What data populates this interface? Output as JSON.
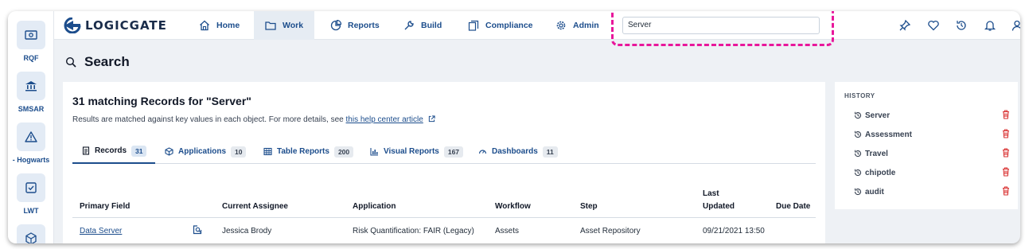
{
  "rail": {
    "items": [
      {
        "label": "RQF",
        "icon": "money-icon"
      },
      {
        "label": "SMSAR",
        "icon": "bank-icon"
      },
      {
        "label": "- Hogwarts",
        "icon": "warning-icon"
      },
      {
        "label": "LWT",
        "icon": "checkbox-icon"
      },
      {
        "label": "",
        "icon": "cube-icon"
      }
    ]
  },
  "nav": {
    "logo": "LOGICGATE",
    "items": [
      {
        "label": "Home",
        "icon": "home-icon"
      },
      {
        "label": "Work",
        "icon": "folder-icon"
      },
      {
        "label": "Reports",
        "icon": "chart-icon"
      },
      {
        "label": "Build",
        "icon": "wrench-icon"
      },
      {
        "label": "Compliance",
        "icon": "documents-icon"
      },
      {
        "label": "Admin",
        "icon": "gear-icon"
      }
    ],
    "search_value": "Server"
  },
  "page": {
    "title": "Search"
  },
  "results": {
    "title": "31 matching Records for \"Server\"",
    "subtitle_text": "Results are matched against key values in each object. For more details, see ",
    "subtitle_link": "this help center article",
    "tabs": [
      {
        "label": "Records",
        "count": "31"
      },
      {
        "label": "Applications",
        "count": "10"
      },
      {
        "label": "Table Reports",
        "count": "200"
      },
      {
        "label": "Visual Reports",
        "count": "167"
      },
      {
        "label": "Dashboards",
        "count": "11"
      }
    ],
    "columns": [
      "Primary Field",
      "Current Assignee",
      "Application",
      "Workflow",
      "Step",
      "Last",
      "Updated",
      "Due Date"
    ],
    "rows": [
      {
        "primary": "Data Server",
        "assignee": "Jessica Brody",
        "application": "Risk Quantification: FAIR (Legacy)",
        "workflow": "Assets",
        "step": "Asset Repository",
        "updated": "09/21/2021 13:50",
        "due": ""
      }
    ]
  },
  "history": {
    "title": "HISTORY",
    "items": [
      "Server",
      "Assessment",
      "Travel",
      "chipotle",
      "audit"
    ]
  },
  "colors": {
    "brand": "#1c4d8c",
    "highlight": "#e8179b",
    "delete": "#d93030"
  }
}
